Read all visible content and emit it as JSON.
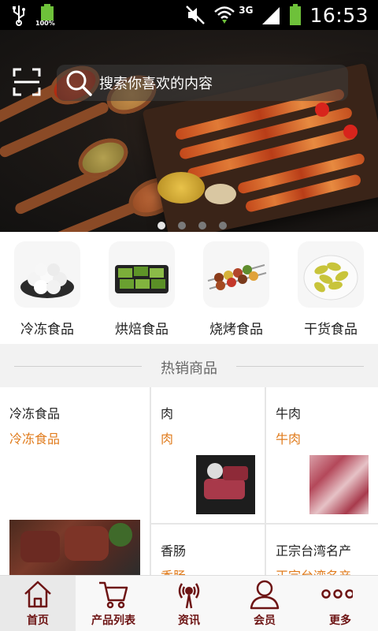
{
  "status_bar": {
    "battery_small": "100%",
    "network": "3G",
    "time": "16:53"
  },
  "banner": {
    "search_placeholder": "搜索你喜欢的内容",
    "page_count": 4,
    "active_page": 1
  },
  "categories": [
    {
      "label": "冷冻食品",
      "icon": "frozen-food-image"
    },
    {
      "label": "烘焙食品",
      "icon": "baked-food-image"
    },
    {
      "label": "烧烤食品",
      "icon": "bbq-food-image"
    },
    {
      "label": "干货食品",
      "icon": "dried-food-image"
    }
  ],
  "hot_section": {
    "title": "热销商品"
  },
  "products": [
    {
      "title": "冷冻食品",
      "subtitle": "冷冻食品"
    },
    {
      "title": "肉",
      "subtitle": "肉"
    },
    {
      "title": "牛肉",
      "subtitle": "牛肉"
    },
    {
      "title": "香肠",
      "subtitle": "香肠"
    },
    {
      "title": "正宗台湾名产",
      "subtitle": "正宗台湾名产"
    }
  ],
  "tabbar": {
    "items": [
      {
        "label": "首页",
        "icon": "home-icon",
        "active": true
      },
      {
        "label": "产品列表",
        "icon": "cart-icon",
        "active": false
      },
      {
        "label": "资讯",
        "icon": "broadcast-icon",
        "active": false
      },
      {
        "label": "会员",
        "icon": "user-icon",
        "active": false
      },
      {
        "label": "更多",
        "icon": "more-icon",
        "active": false
      }
    ]
  },
  "colors": {
    "accent_orange": "#e07b1c",
    "tab_text": "#6d1414"
  }
}
